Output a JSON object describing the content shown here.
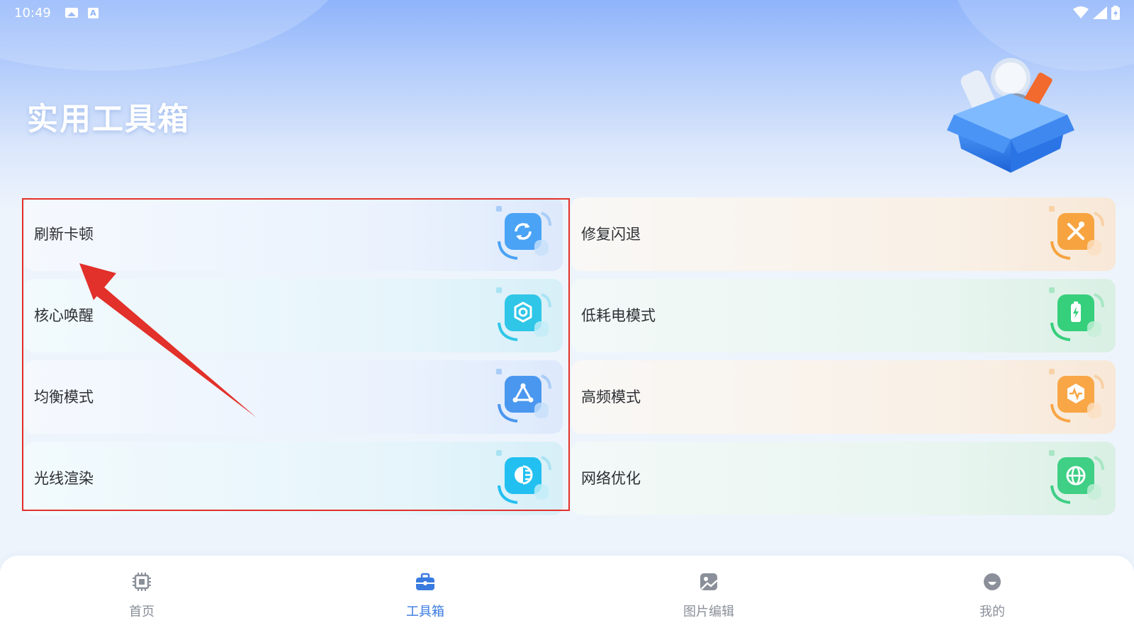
{
  "status_bar": {
    "time": "10:49"
  },
  "header": {
    "title": "实用工具箱"
  },
  "tools_left": [
    {
      "label": "刷新卡顿",
      "icon": "refresh-icon",
      "color": "#4aa3f5"
    },
    {
      "label": "核心唤醒",
      "icon": "core-hexagon-icon",
      "color": "#2fc6e8"
    },
    {
      "label": "均衡模式",
      "icon": "balance-triangle-icon",
      "color": "#4a97ef"
    },
    {
      "label": "光线渲染",
      "icon": "light-render-icon",
      "color": "#22c0f0"
    }
  ],
  "tools_right": [
    {
      "label": "修复闪退",
      "icon": "repair-tools-icon",
      "color": "#f7a440"
    },
    {
      "label": "低耗电模式",
      "icon": "battery-saver-icon",
      "color": "#36cf7c"
    },
    {
      "label": "高频模式",
      "icon": "pulse-hexagon-icon",
      "color": "#f8a646"
    },
    {
      "label": "网络优化",
      "icon": "globe-icon",
      "color": "#3fcf85"
    }
  ],
  "tabbar": {
    "items": [
      {
        "label": "首页",
        "icon": "chip-icon",
        "active": false
      },
      {
        "label": "工具箱",
        "icon": "toolbox-icon",
        "active": true
      },
      {
        "label": "图片编辑",
        "icon": "image-edit-icon",
        "active": false
      },
      {
        "label": "我的",
        "icon": "profile-icon",
        "active": false
      }
    ]
  },
  "colors": {
    "accent": "#3a7be0",
    "highlight": "#e2302a"
  }
}
